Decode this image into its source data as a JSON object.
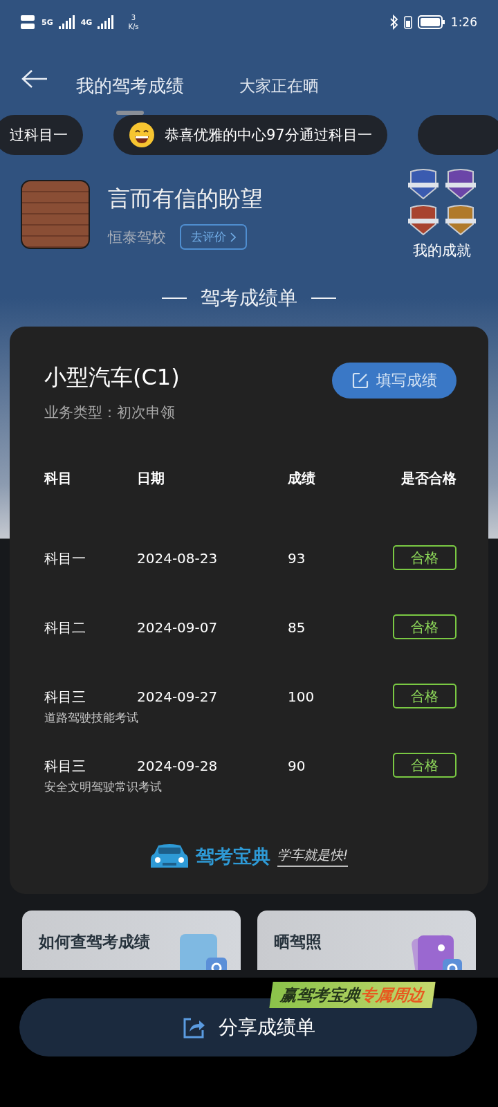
{
  "status_bar": {
    "net_5g": "5G",
    "net_4g": "4G",
    "speed_value": "3",
    "speed_unit": "K/s",
    "time": "1:26"
  },
  "tabs": [
    {
      "label": "我的驾考成绩",
      "selected": true
    },
    {
      "label": "大家正在晒",
      "selected": false
    }
  ],
  "ticker": [
    {
      "kind": "partial",
      "text": "过科目一"
    },
    {
      "kind": "emoji",
      "text": "恭喜优雅的中心97分通过科目一"
    },
    {
      "kind": "stub"
    }
  ],
  "profile": {
    "name": "言而有信的盼望",
    "school": "恒泰驾校",
    "review_button": "去评价",
    "achievements_label": "我的成就",
    "badges": [
      {
        "color": "#3a5bb0"
      },
      {
        "color": "#6b45a8"
      },
      {
        "color": "#a8432f"
      },
      {
        "color": "#b07a2a"
      }
    ]
  },
  "section_title": "驾考成绩单",
  "card": {
    "title": "小型汽车(C1)",
    "fill_button": "填写成绩",
    "business_type": "业务类型：初次申领",
    "columns": [
      "科目",
      "日期",
      "成绩",
      "是否合格"
    ],
    "rows": [
      {
        "subject": "科目一",
        "date": "2024-08-23",
        "score": "93",
        "result": "合格",
        "passed": true
      },
      {
        "subject": "科目二",
        "date": "2024-09-07",
        "score": "85",
        "result": "合格",
        "passed": true
      },
      {
        "subject": "科目三",
        "date": "2024-09-27",
        "score": "100",
        "result": "合格",
        "passed": true,
        "note": "道路驾驶技能考试"
      },
      {
        "subject": "科目三",
        "date": "2024-09-28",
        "score": "90",
        "result": "合格",
        "passed": true,
        "note": "安全文明驾驶常识考试"
      }
    ],
    "brand": "驾考宝典",
    "slogan": "学车就是快!"
  },
  "tiles": [
    {
      "kind": "query",
      "label": "如何查驾考成绩"
    },
    {
      "kind": "photo",
      "label": "晒驾照"
    }
  ],
  "promo": {
    "text": "赢驾考宝典",
    "highlight": "专属周边"
  },
  "share_button": "分享成绩单"
}
